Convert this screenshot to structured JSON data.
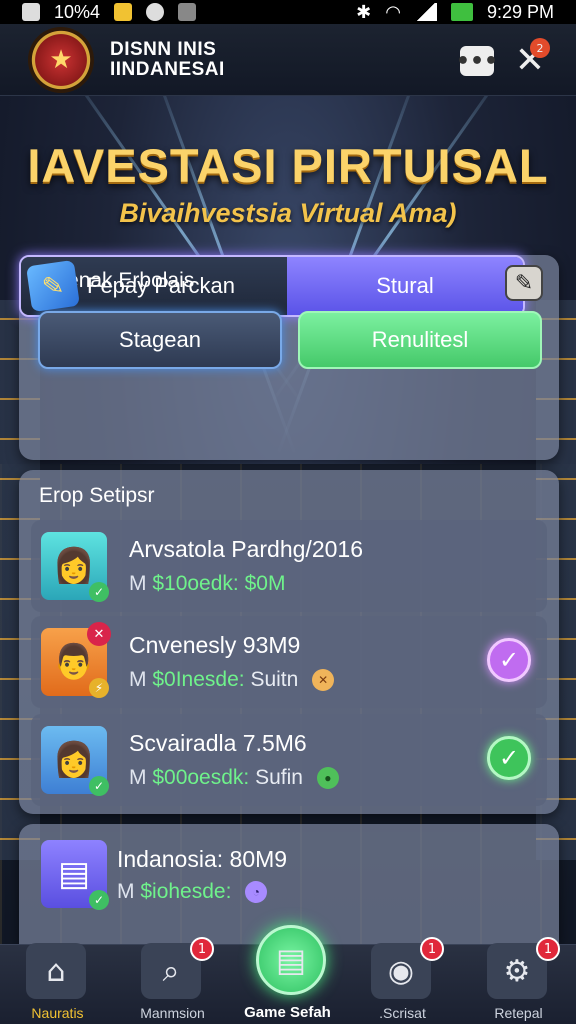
{
  "status_bar": {
    "left_text": "10%4",
    "time": "9:29 PM",
    "icons": [
      "square-icon",
      "battery-small-icon",
      "settings-icon",
      "camera-icon",
      "bluetooth-icon",
      "wifi-icon",
      "signal-icon",
      "battery-icon"
    ]
  },
  "header": {
    "brand_line1": "DISNN INIS",
    "brand_line2": "IINDANESAI",
    "menu_label": "•••",
    "close_label": "✕",
    "close_badge": "2"
  },
  "titles": {
    "main": "IAVESTASI PIRTUISAL",
    "sub": "Bivaihvestsia Virtual Ama)"
  },
  "panel_one": {
    "title": "Invenak Erbolais",
    "stage_button": "Stagean",
    "result_button": "Renulitesl",
    "split_left": "Fepay Parckan",
    "split_right": "Stural"
  },
  "panel_two": {
    "title": "Erop Setipsr",
    "items": [
      {
        "name": "Arvsatola Pardhg/2016",
        "prefix": "M",
        "amount": "$10oedk: $0M",
        "detail": "",
        "status": "none"
      },
      {
        "name": "Cnvenesly 93M9",
        "prefix": "M",
        "amount": "$0Inesde:",
        "detail": "Suitn",
        "status": "selected-violet"
      },
      {
        "name": "Scvairadla 7.5M6",
        "prefix": "M",
        "amount": "$00oesdk:",
        "detail": "Sufin",
        "status": "selected-green"
      }
    ]
  },
  "panel_three": {
    "name": "Indanosia: 80M9",
    "prefix": "M",
    "amount": "$iohesde:"
  },
  "bottom_nav": [
    {
      "label": "Nauratis",
      "icon": "home-icon",
      "badge": "",
      "active": true
    },
    {
      "label": "Manmsion",
      "icon": "search-doc-icon",
      "badge": "1",
      "active": false
    },
    {
      "label": "Game Sefah",
      "icon": "chat-icon",
      "badge": "",
      "active": false
    },
    {
      "label": ".Scrisat",
      "icon": "camera-icon",
      "badge": "1",
      "active": false
    },
    {
      "label": "Retepal",
      "icon": "gear-icon",
      "badge": "1",
      "active": false
    }
  ],
  "colors": {
    "title_gold": "#fbd36a",
    "accent_green": "#45c96a",
    "accent_violet": "#8e84ff",
    "badge_red": "#e0283b"
  }
}
